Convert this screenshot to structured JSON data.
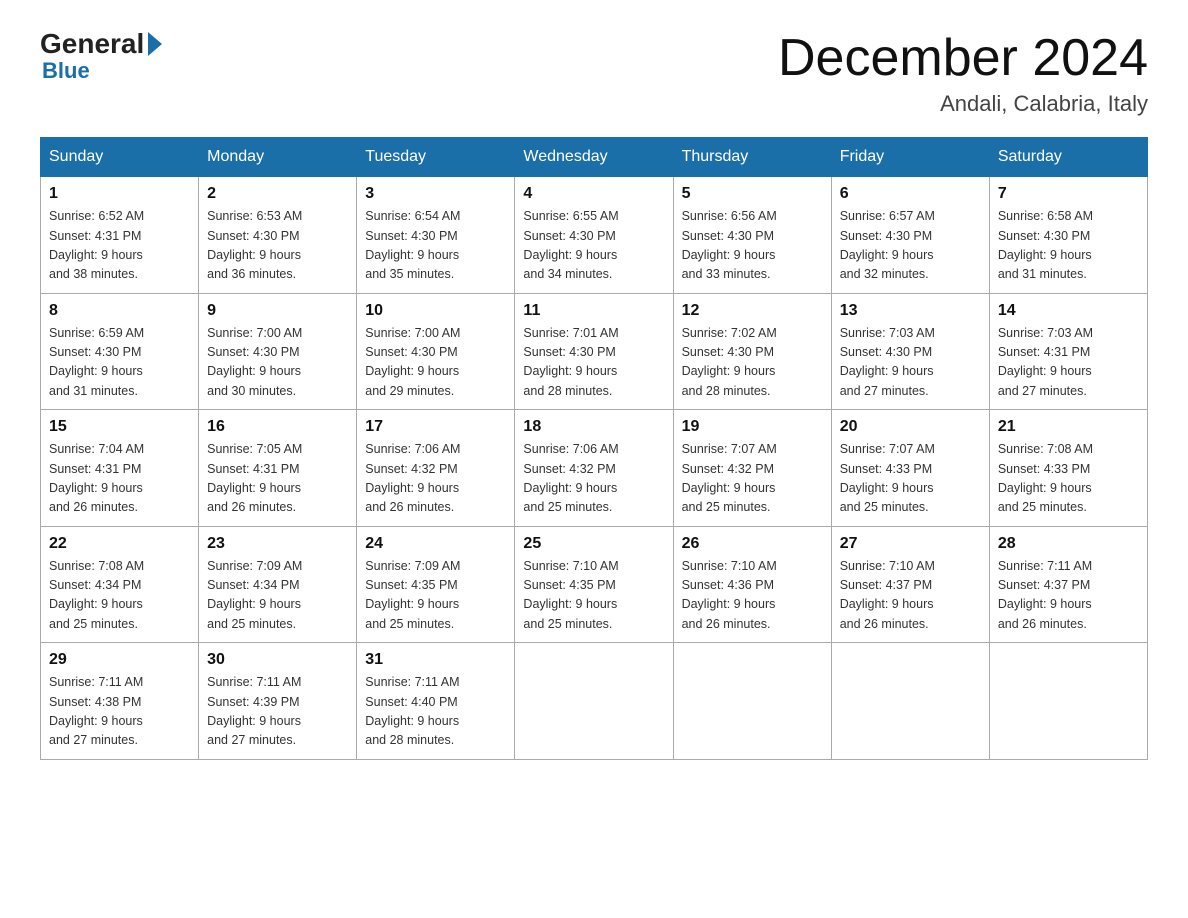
{
  "header": {
    "logo_general": "General",
    "logo_blue": "Blue",
    "title": "December 2024",
    "location": "Andali, Calabria, Italy"
  },
  "days_of_week": [
    "Sunday",
    "Monday",
    "Tuesday",
    "Wednesday",
    "Thursday",
    "Friday",
    "Saturday"
  ],
  "weeks": [
    [
      {
        "day": "1",
        "sunrise": "6:52 AM",
        "sunset": "4:31 PM",
        "daylight": "9 hours and 38 minutes."
      },
      {
        "day": "2",
        "sunrise": "6:53 AM",
        "sunset": "4:30 PM",
        "daylight": "9 hours and 36 minutes."
      },
      {
        "day": "3",
        "sunrise": "6:54 AM",
        "sunset": "4:30 PM",
        "daylight": "9 hours and 35 minutes."
      },
      {
        "day": "4",
        "sunrise": "6:55 AM",
        "sunset": "4:30 PM",
        "daylight": "9 hours and 34 minutes."
      },
      {
        "day": "5",
        "sunrise": "6:56 AM",
        "sunset": "4:30 PM",
        "daylight": "9 hours and 33 minutes."
      },
      {
        "day": "6",
        "sunrise": "6:57 AM",
        "sunset": "4:30 PM",
        "daylight": "9 hours and 32 minutes."
      },
      {
        "day": "7",
        "sunrise": "6:58 AM",
        "sunset": "4:30 PM",
        "daylight": "9 hours and 31 minutes."
      }
    ],
    [
      {
        "day": "8",
        "sunrise": "6:59 AM",
        "sunset": "4:30 PM",
        "daylight": "9 hours and 31 minutes."
      },
      {
        "day": "9",
        "sunrise": "7:00 AM",
        "sunset": "4:30 PM",
        "daylight": "9 hours and 30 minutes."
      },
      {
        "day": "10",
        "sunrise": "7:00 AM",
        "sunset": "4:30 PM",
        "daylight": "9 hours and 29 minutes."
      },
      {
        "day": "11",
        "sunrise": "7:01 AM",
        "sunset": "4:30 PM",
        "daylight": "9 hours and 28 minutes."
      },
      {
        "day": "12",
        "sunrise": "7:02 AM",
        "sunset": "4:30 PM",
        "daylight": "9 hours and 28 minutes."
      },
      {
        "day": "13",
        "sunrise": "7:03 AM",
        "sunset": "4:30 PM",
        "daylight": "9 hours and 27 minutes."
      },
      {
        "day": "14",
        "sunrise": "7:03 AM",
        "sunset": "4:31 PM",
        "daylight": "9 hours and 27 minutes."
      }
    ],
    [
      {
        "day": "15",
        "sunrise": "7:04 AM",
        "sunset": "4:31 PM",
        "daylight": "9 hours and 26 minutes."
      },
      {
        "day": "16",
        "sunrise": "7:05 AM",
        "sunset": "4:31 PM",
        "daylight": "9 hours and 26 minutes."
      },
      {
        "day": "17",
        "sunrise": "7:06 AM",
        "sunset": "4:32 PM",
        "daylight": "9 hours and 26 minutes."
      },
      {
        "day": "18",
        "sunrise": "7:06 AM",
        "sunset": "4:32 PM",
        "daylight": "9 hours and 25 minutes."
      },
      {
        "day": "19",
        "sunrise": "7:07 AM",
        "sunset": "4:32 PM",
        "daylight": "9 hours and 25 minutes."
      },
      {
        "day": "20",
        "sunrise": "7:07 AM",
        "sunset": "4:33 PM",
        "daylight": "9 hours and 25 minutes."
      },
      {
        "day": "21",
        "sunrise": "7:08 AM",
        "sunset": "4:33 PM",
        "daylight": "9 hours and 25 minutes."
      }
    ],
    [
      {
        "day": "22",
        "sunrise": "7:08 AM",
        "sunset": "4:34 PM",
        "daylight": "9 hours and 25 minutes."
      },
      {
        "day": "23",
        "sunrise": "7:09 AM",
        "sunset": "4:34 PM",
        "daylight": "9 hours and 25 minutes."
      },
      {
        "day": "24",
        "sunrise": "7:09 AM",
        "sunset": "4:35 PM",
        "daylight": "9 hours and 25 minutes."
      },
      {
        "day": "25",
        "sunrise": "7:10 AM",
        "sunset": "4:35 PM",
        "daylight": "9 hours and 25 minutes."
      },
      {
        "day": "26",
        "sunrise": "7:10 AM",
        "sunset": "4:36 PM",
        "daylight": "9 hours and 26 minutes."
      },
      {
        "day": "27",
        "sunrise": "7:10 AM",
        "sunset": "4:37 PM",
        "daylight": "9 hours and 26 minutes."
      },
      {
        "day": "28",
        "sunrise": "7:11 AM",
        "sunset": "4:37 PM",
        "daylight": "9 hours and 26 minutes."
      }
    ],
    [
      {
        "day": "29",
        "sunrise": "7:11 AM",
        "sunset": "4:38 PM",
        "daylight": "9 hours and 27 minutes."
      },
      {
        "day": "30",
        "sunrise": "7:11 AM",
        "sunset": "4:39 PM",
        "daylight": "9 hours and 27 minutes."
      },
      {
        "day": "31",
        "sunrise": "7:11 AM",
        "sunset": "4:40 PM",
        "daylight": "9 hours and 28 minutes."
      },
      null,
      null,
      null,
      null
    ]
  ],
  "labels": {
    "sunrise": "Sunrise:",
    "sunset": "Sunset:",
    "daylight": "Daylight:"
  }
}
